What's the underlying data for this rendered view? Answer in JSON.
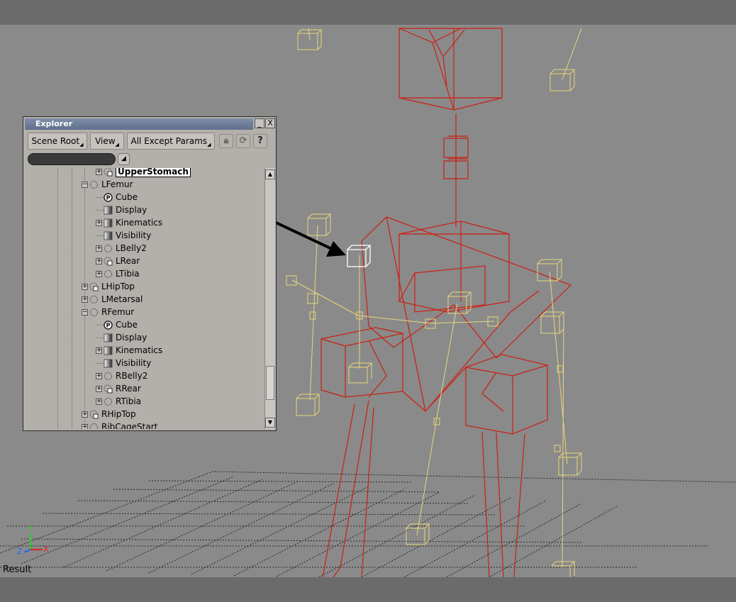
{
  "viewport": {
    "result_label": "Result",
    "axes": {
      "x": "X",
      "y": "Y",
      "z": "Z"
    }
  },
  "explorer": {
    "title": "Explorer",
    "title_buttons": {
      "minimize": "_",
      "close": "X"
    },
    "toolbar": {
      "scene_root": "Scene Root",
      "view": "View",
      "filter_mode": "All Except Params"
    },
    "icons": [
      "lock-icon",
      "refresh-icon",
      "help-icon"
    ],
    "tree": [
      {
        "label": "UpperStomach",
        "selected": true,
        "icon": "null-icon"
      },
      {
        "label": "LFemur",
        "icon": "bone-icon"
      },
      {
        "label": "Cube",
        "icon": "primitive-icon"
      },
      {
        "label": "Display",
        "icon": "property-icon"
      },
      {
        "label": "Kinematics",
        "icon": "property-icon"
      },
      {
        "label": "Visibility",
        "icon": "property-icon"
      },
      {
        "label": "LBelly2",
        "icon": "bone-icon"
      },
      {
        "label": "LRear",
        "icon": "null-icon"
      },
      {
        "label": "LTibia",
        "icon": "bone-icon"
      },
      {
        "label": "LHipTop",
        "icon": "null-icon"
      },
      {
        "label": "LMetarsal",
        "icon": "bone-icon"
      },
      {
        "label": "RFemur",
        "icon": "bone-icon"
      },
      {
        "label": "Cube",
        "icon": "primitive-icon"
      },
      {
        "label": "Display",
        "icon": "property-icon"
      },
      {
        "label": "Kinematics",
        "icon": "property-icon"
      },
      {
        "label": "Visibility",
        "icon": "property-icon"
      },
      {
        "label": "RBelly2",
        "icon": "bone-icon"
      },
      {
        "label": "RRear",
        "icon": "null-icon"
      },
      {
        "label": "RTibia",
        "icon": "bone-icon"
      },
      {
        "label": "RHipTop",
        "icon": "null-icon"
      },
      {
        "label": "RibCageStart",
        "icon": "bone-icon"
      }
    ]
  },
  "colors": {
    "viewport_bg": "#8a8a8a",
    "bone_red": "#cc1f12",
    "null_yellow": "#e8d77a",
    "selected_white": "#ffffff",
    "grid": "#222222",
    "panel_bg": "#b3b0ab",
    "title_bar": "#6f7e99"
  }
}
